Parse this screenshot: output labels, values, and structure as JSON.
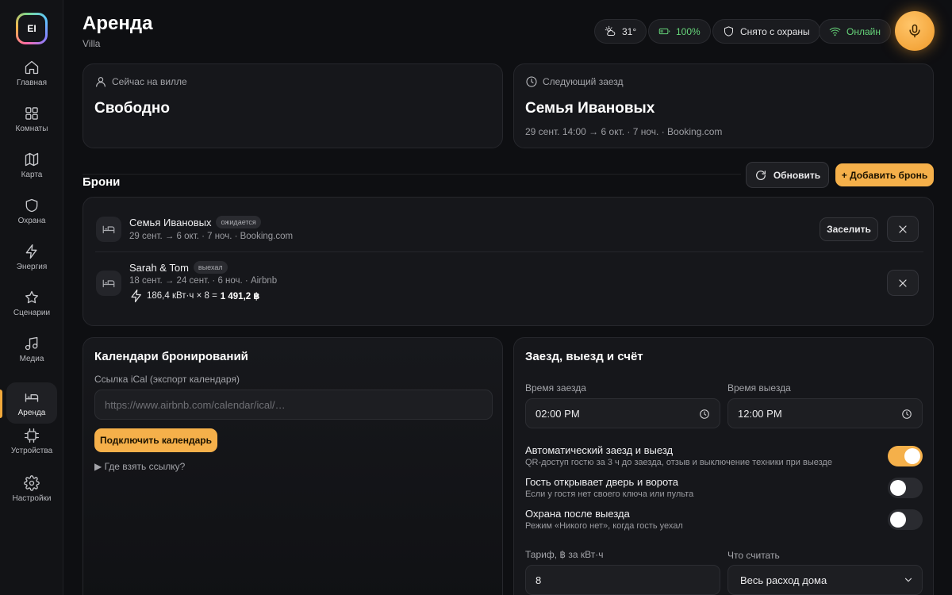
{
  "logo": {
    "text": "EI"
  },
  "nav": [
    {
      "label": "Главная",
      "icon": "home-icon"
    },
    {
      "label": "Комнаты",
      "icon": "grid-icon"
    },
    {
      "label": "Карта",
      "icon": "map-icon"
    },
    {
      "label": "Охрана",
      "icon": "shield-icon"
    },
    {
      "label": "Энергия",
      "icon": "bolt-icon"
    },
    {
      "label": "Сценарии",
      "icon": "star-icon"
    },
    {
      "label": "Медиа",
      "icon": "music-icon"
    },
    {
      "label": "Аренда",
      "icon": "bed-icon",
      "active": true
    },
    {
      "label": "Устройства",
      "icon": "chip-icon"
    },
    {
      "label": "Настройки",
      "icon": "gear-icon"
    }
  ],
  "header": {
    "title": "Аренда",
    "subtitle": "Villa",
    "weather": "31°",
    "battery": "100%",
    "security": "Снято с охраны",
    "network": "Онлайн"
  },
  "now": {
    "label": "Сейчас на вилле",
    "value": "Свободно"
  },
  "next": {
    "label": "Следующий заезд",
    "value": "Семья Ивановых",
    "meta": "29 сент. 14:00 → 6 окт. · 7 ноч. · Booking.com"
  },
  "bookings": {
    "title": "Брони",
    "refresh_label": "Обновить",
    "add_label": "+ Добавить бронь",
    "items": [
      {
        "name": "Семья Ивановых",
        "tag": "ожидается",
        "meta": "29 сент. → 6 окт. · 7 ноч. · Booking.com",
        "action": "Заселить"
      },
      {
        "name": "Sarah & Tom",
        "tag": "выехал",
        "meta": "18 сент. → 24 сент. · 6 ноч. · Airbnb",
        "energy": "186,4 кВт·ч × 8 =",
        "energy_total": "1 491,2 ฿"
      }
    ]
  },
  "calendars": {
    "title": "Календари бронирований",
    "ical_label": "Ссылка iCal (экспорт календаря)",
    "ical_placeholder": "https://www.airbnb.com/calendar/ical/…",
    "connect_label": "Подключить календарь",
    "help": "▶  Где взять ссылку?"
  },
  "checkin": {
    "title": "Заезд, выезд и счёт",
    "checkin_label": "Время заезда",
    "checkin_value": "02:00 PM",
    "checkout_label": "Время выезда",
    "checkout_value": "12:00 PM",
    "toggles": [
      {
        "title": "Автоматический заезд и выезд",
        "desc": "QR-доступ гостю за 3 ч до заезда, отзыв и выключение техники при выезде",
        "on": true
      },
      {
        "title": "Гость открывает дверь и ворота",
        "desc": "Если у гостя нет своего ключа или пульта",
        "on": false
      },
      {
        "title": "Охрана после выезда",
        "desc": "Режим «Никого нет», когда гость уехал",
        "on": false
      }
    ],
    "tariff_label": "Тариф, ฿ за кВт·ч",
    "tariff_value": "8",
    "count_label": "Что считать",
    "count_value": "Весь расход дома"
  },
  "colors": {
    "accent": "#f5b04a",
    "online": "#66d57a",
    "background": "#0e0f12"
  }
}
